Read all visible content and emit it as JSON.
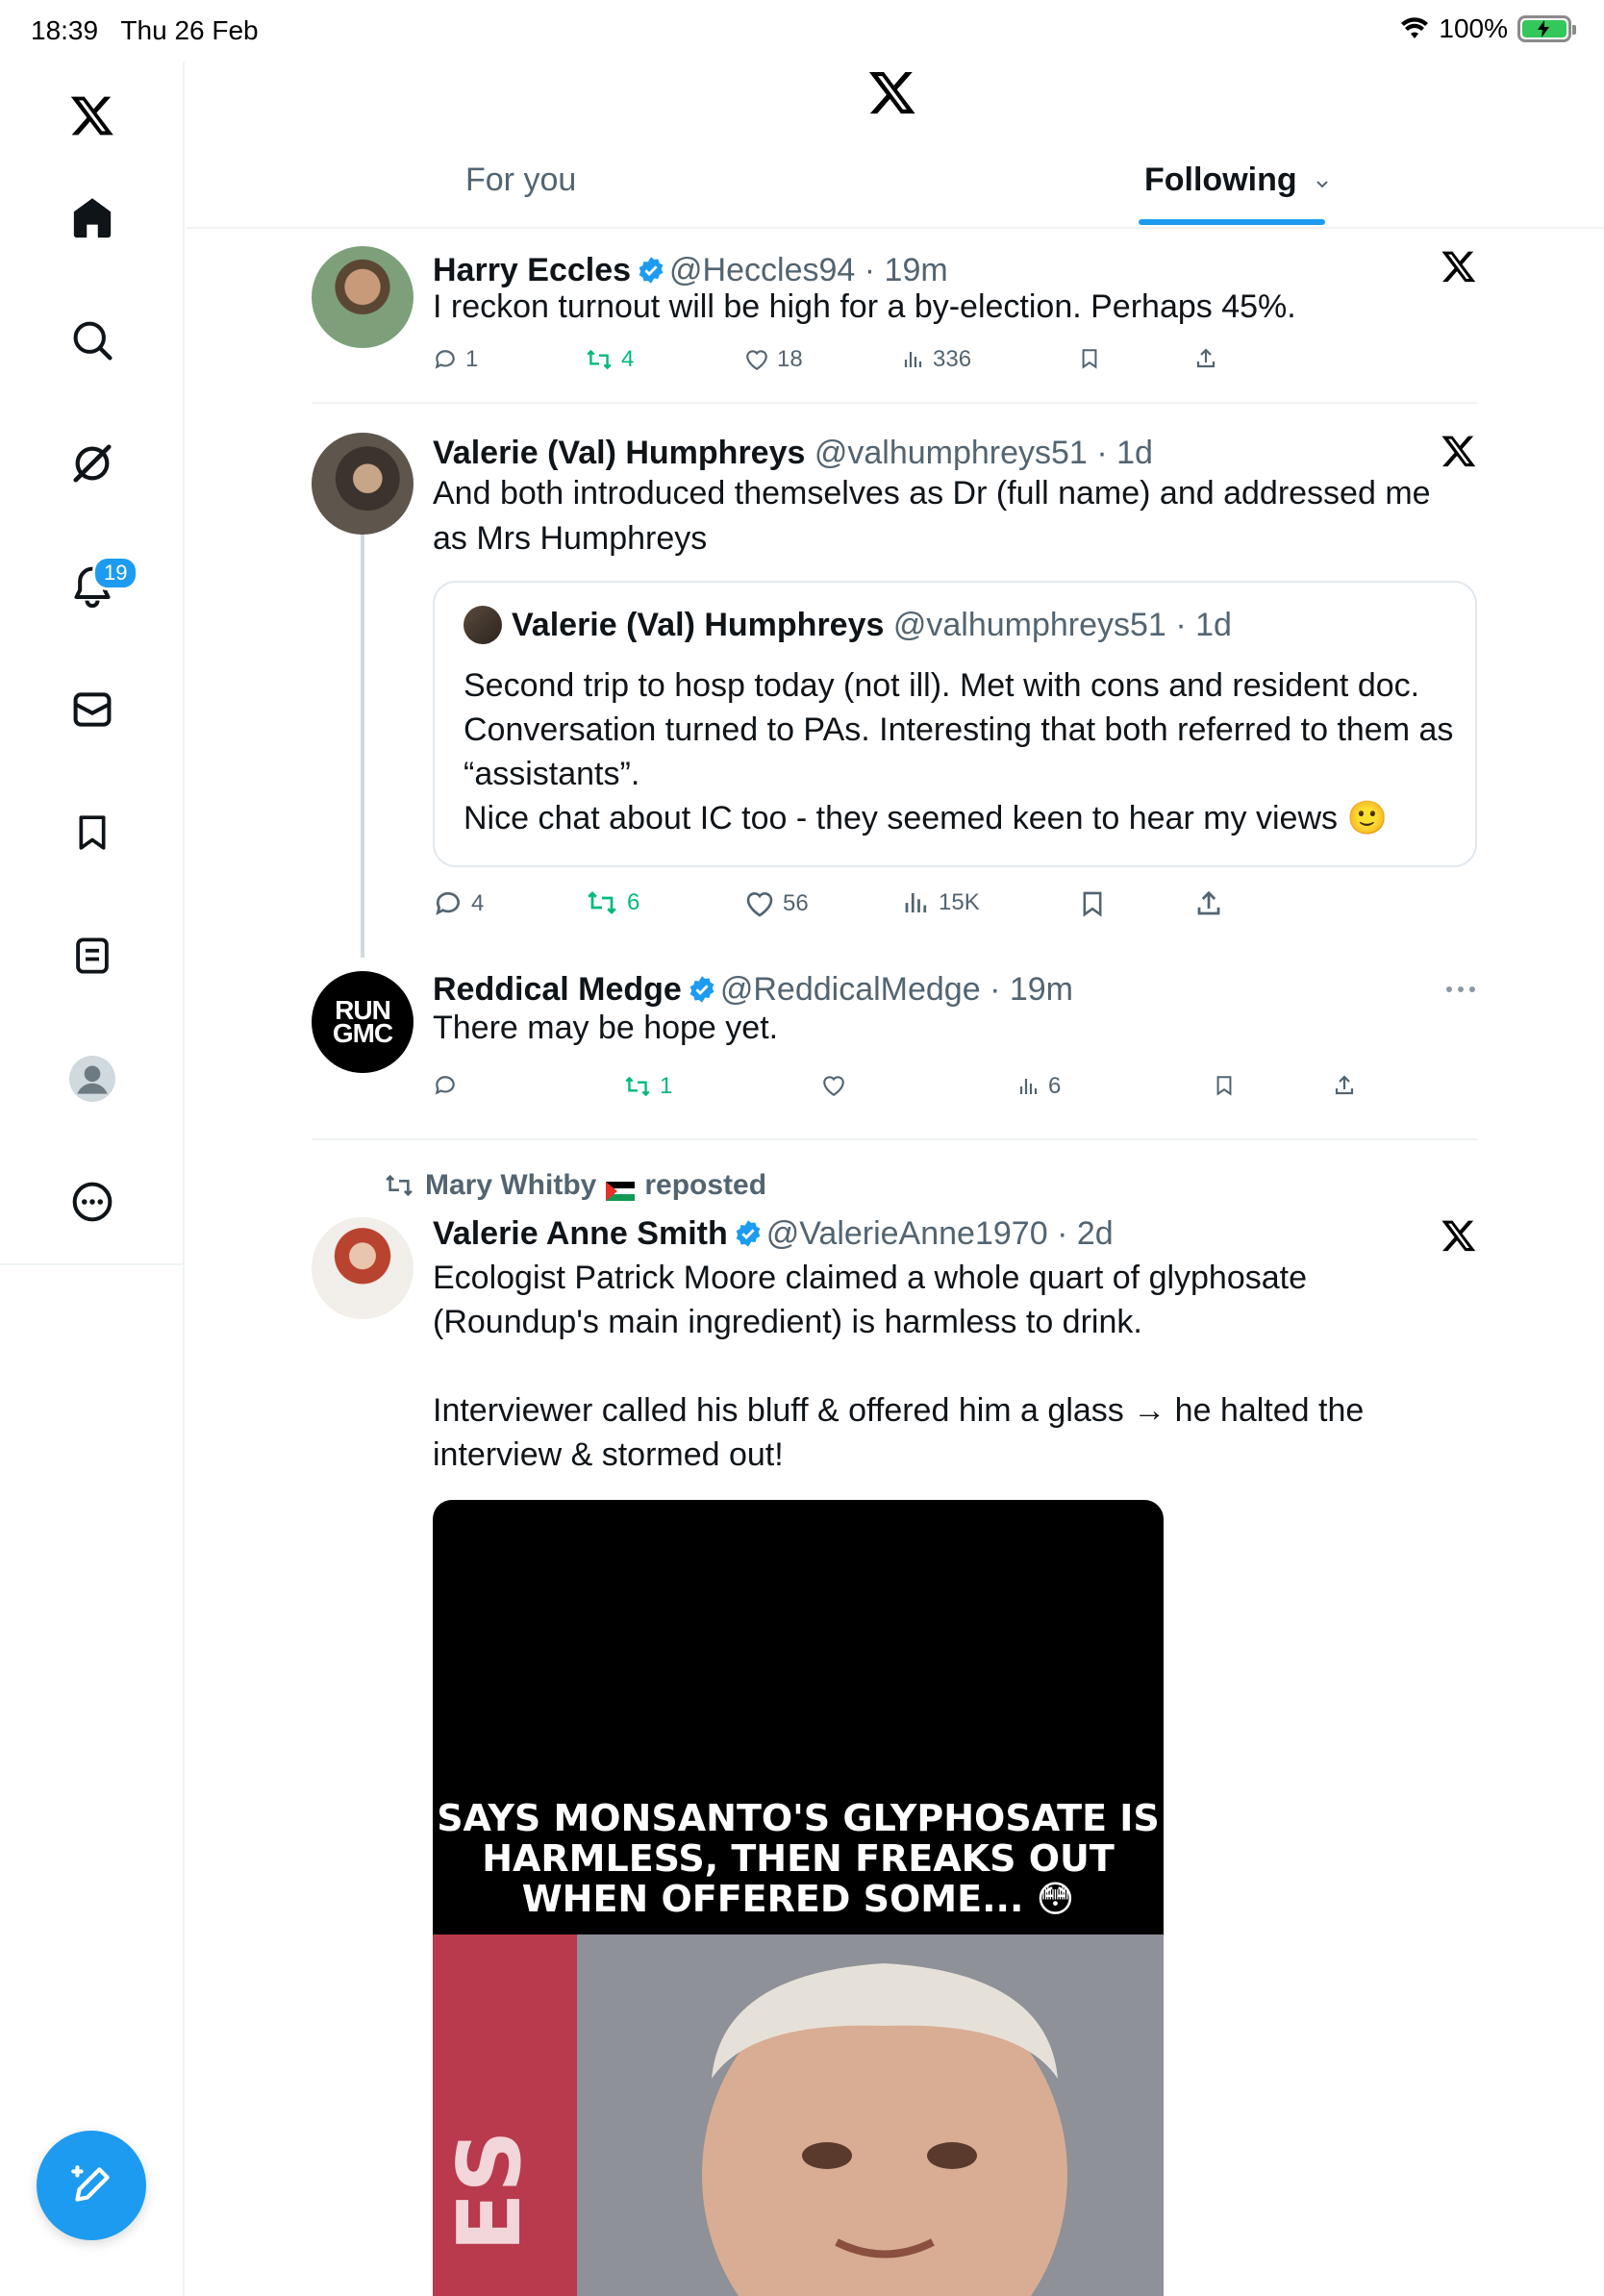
{
  "status_bar": {
    "time": "18:39",
    "date": "Thu 26 Feb",
    "battery": "100%"
  },
  "nav": {
    "notifications_badge": "19"
  },
  "tabs": {
    "for_you": "For you",
    "following": "Following"
  },
  "tweets": [
    {
      "name": "Harry Eccles",
      "handle": "@Heccles94",
      "time": "· 19m",
      "text": "I reckon turnout will be high for a by-election. Perhaps 45%.",
      "replies": "1",
      "reposts": "4",
      "likes": "18",
      "views": "336"
    },
    {
      "name": "Valerie (Val) Humphreys",
      "handle": "@valhumphreys51",
      "time": "· 1d",
      "text": "And both introduced themselves as Dr (full name) and addressed me as Mrs Humphreys",
      "quote": {
        "name": "Valerie (Val) Humphreys",
        "handle": "@valhumphreys51",
        "time": "· 1d",
        "text": "Second trip to hosp today (not ill). Met with cons and resident doc. Conversation turned to PAs. Interesting that both referred to them as “assistants”.\nNice chat about IC too - they seemed keen to hear my views 🙂"
      },
      "replies": "4",
      "reposts": "6",
      "likes": "56",
      "views": "15K"
    },
    {
      "name": "Reddical Medge",
      "handle": "@ReddicalMedge",
      "time": "· 19m",
      "avatar_text": "RUN GMC",
      "text": "There may be hope yet.",
      "reposts": "1",
      "views": "6"
    },
    {
      "reposted_by": "Mary Whitby",
      "reposted_label": "reposted",
      "name": "Valerie Anne Smith",
      "handle": "@ValerieAnne1970",
      "time": "· 2d",
      "text": "Ecologist Patrick Moore claimed a whole quart of glyphosate (Roundup's main ingredient) is harmless to drink.\n\nInterviewer called his bluff & offered him a glass → he halted the interview & stormed out!",
      "media_caption": "SAYS MONSANTO'S GLYPHOSATE IS HARMLESS, THEN FREAKS OUT WHEN OFFERED SOME... 😳"
    }
  ],
  "colors": {
    "accent": "#1d9bf0",
    "repost": "#00ba7c",
    "muted": "#536471"
  }
}
